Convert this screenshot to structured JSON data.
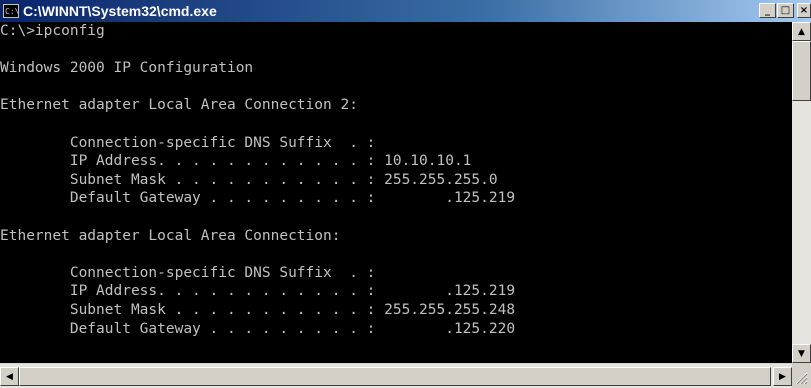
{
  "window": {
    "title": "C:\\WINNT\\System32\\cmd.exe",
    "icon_text": "C:\\",
    "buttons": {
      "minimize": "_",
      "maximize": "□",
      "close": "×"
    }
  },
  "console": {
    "lines": [
      "C:\\>ipconfig",
      "",
      "Windows 2000 IP Configuration",
      "",
      "Ethernet adapter Local Area Connection 2:",
      "",
      "        Connection-specific DNS Suffix  . :",
      "        IP Address. . . . . . . . . . . . : 10.10.10.1",
      "        Subnet Mask . . . . . . . . . . . : 255.255.255.0",
      "        Default Gateway . . . . . . . . . :        .125.219",
      "",
      "Ethernet adapter Local Area Connection:",
      "",
      "        Connection-specific DNS Suffix  . :",
      "        IP Address. . . . . . . . . . . . :        .125.219",
      "        Subnet Mask . . . . . . . . . . . : 255.255.255.248",
      "        Default Gateway . . . . . . . . . :        .125.220"
    ]
  },
  "scrollbars": {
    "up_arrow": "▲",
    "down_arrow": "▼",
    "left_arrow": "◀",
    "right_arrow": "▶"
  }
}
